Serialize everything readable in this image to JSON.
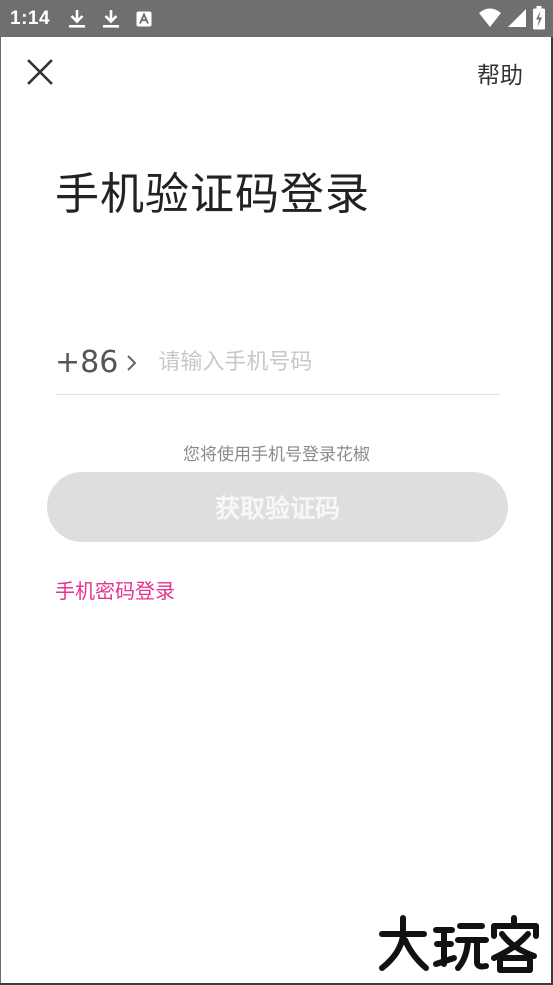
{
  "status_bar": {
    "time": "1:14",
    "icons": [
      "download-icon",
      "download-icon",
      "a-badge-icon",
      "wifi-icon",
      "signal-icon",
      "battery-charging-icon"
    ]
  },
  "header": {
    "help_label": "帮助"
  },
  "title": "手机验证码登录",
  "phone": {
    "country_code": "+86",
    "placeholder": "请输入手机号码",
    "value": ""
  },
  "hint": "您将使用手机号登录花椒",
  "get_code_label": "获取验证码",
  "alt_login_label": "手机密码登录",
  "colors": {
    "accent": "#e5338f",
    "button_disabled": "#dedede",
    "status_bar": "#6f6f6f"
  },
  "watermark_text": "大玩客"
}
